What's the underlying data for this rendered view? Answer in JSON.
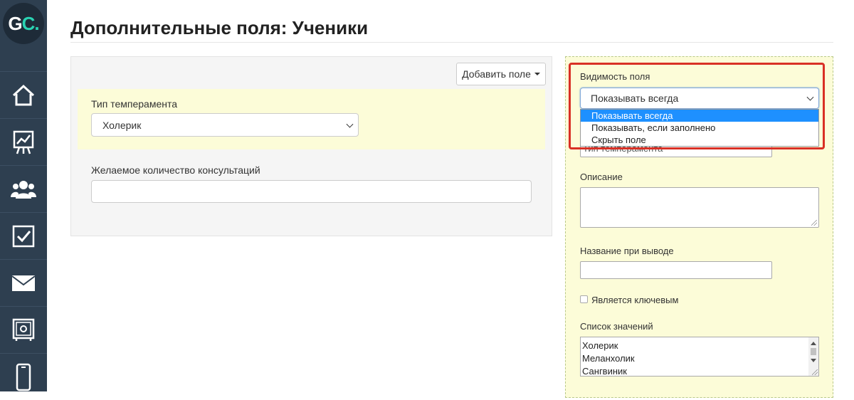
{
  "logo": {
    "text_g": "G",
    "text_c": "C."
  },
  "sidebar": {
    "items": [
      {
        "icon": "home-icon"
      },
      {
        "icon": "chart-icon"
      },
      {
        "icon": "users-icon"
      },
      {
        "icon": "checkbox-icon"
      },
      {
        "icon": "mail-icon"
      },
      {
        "icon": "safe-icon"
      },
      {
        "icon": "phone-icon"
      }
    ]
  },
  "page": {
    "title": "Дополнительные поля: Ученики"
  },
  "left": {
    "add_button_label": "Добавить поле",
    "temperament": {
      "label": "Тип темперамента",
      "value": "Холерик"
    },
    "consultations": {
      "label": "Желаемое количество консультаций",
      "value": ""
    }
  },
  "right": {
    "visibility": {
      "label": "Видимость поля",
      "value": "Показывать всегда",
      "options": [
        "Показывать всегда",
        "Показывать, если заполнено",
        "Скрыть поле"
      ]
    },
    "name_field_value": "Тип темперамента",
    "description_label": "Описание",
    "output_name_label": "Название при выводе",
    "is_key_label": "Является ключевым",
    "values_list_label": "Список значений",
    "values": [
      "Холерик",
      "Меланхолик",
      "Сангвиник"
    ]
  },
  "colors": {
    "sidebar": "#2e3f50",
    "accent": "#2ad3b3",
    "highlight": "#d93025",
    "field_yellow": "#fcfcd8",
    "selected_option": "#1e90ff"
  }
}
